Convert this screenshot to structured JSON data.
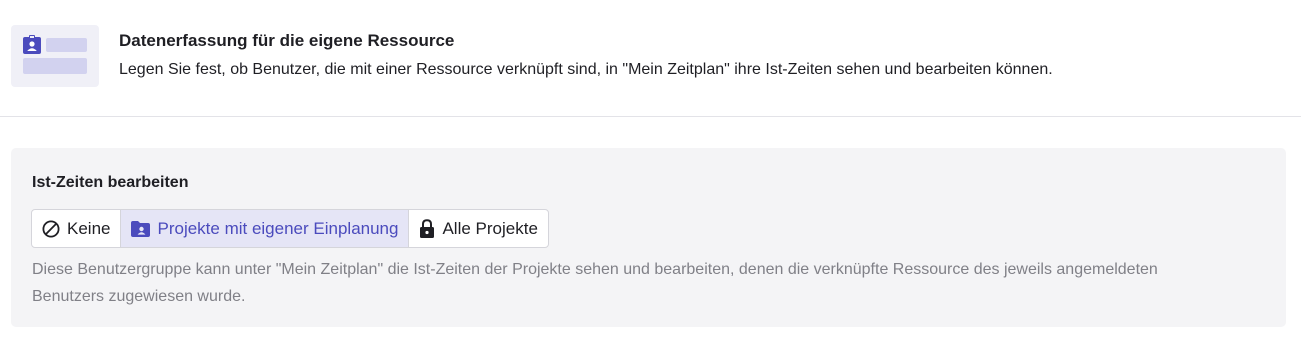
{
  "header": {
    "title": "Datenerfassung für die eigene Ressource",
    "description": "Legen Sie fest, ob Benutzer, die mit einer Ressource verknüpft sind, in \"Mein Zeitplan\" ihre Ist-Zeiten sehen und bearbeiten können.",
    "illustration_icon": "badge-icon"
  },
  "setting": {
    "label": "Ist-Zeiten bearbeiten",
    "options": [
      {
        "label": "Keine",
        "icon": "prohibited-icon",
        "selected": false
      },
      {
        "label": "Projekte mit eigener Einplanung",
        "icon": "folder-user-icon",
        "selected": true
      },
      {
        "label": "Alle Projekte",
        "icon": "lock-icon",
        "selected": false
      }
    ],
    "help_text": "Diese Benutzergruppe kann unter \"Mein Zeitplan\" die Ist-Zeiten der Projekte sehen und bearbeiten, denen die verknüpfte Ressource des jeweils angemeldeten Benutzers zugewiesen wurde."
  },
  "colors": {
    "accent": "#4b4bbd",
    "selected_bg": "#e5e5f6",
    "panel_bg": "#f4f4f6",
    "muted_text": "#808087"
  }
}
